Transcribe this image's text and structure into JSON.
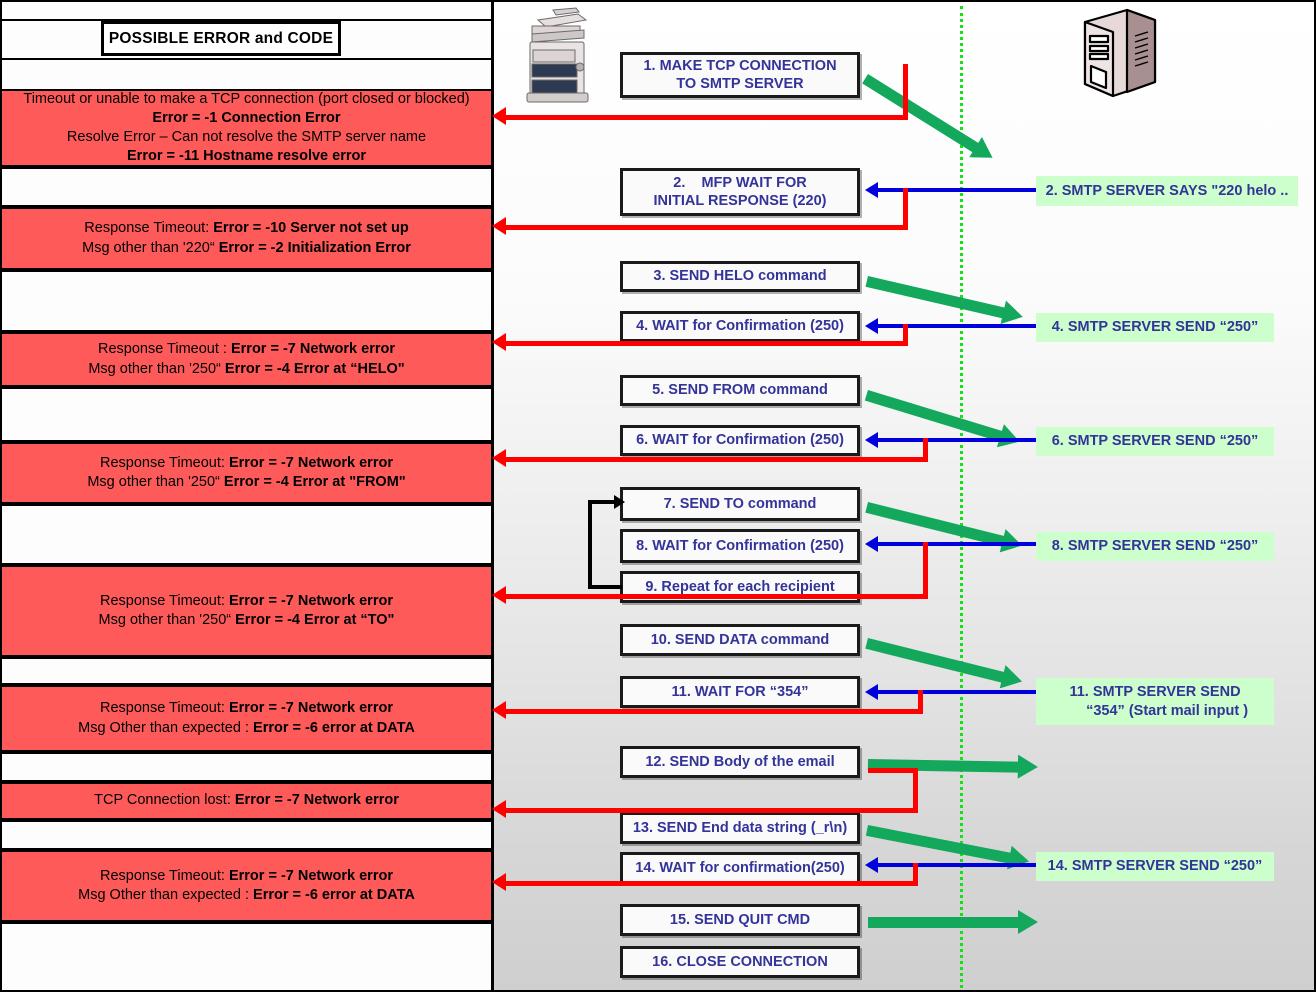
{
  "title_box": {
    "label": "POSSIBLE ERROR and CODE"
  },
  "devices": {
    "mfp": {
      "name": "mfp-printer-icon"
    },
    "server": {
      "name": "smtp-server-icon"
    }
  },
  "errors": [
    {
      "id": "err-1",
      "lines": [
        {
          "t": "Timeout or unable to make a TCP connection (port closed or blocked)",
          "b": false
        },
        {
          "t": "Error = -1 Connection Error",
          "b": true
        },
        {
          "t": "Resolve Error – Can not resolve the SMTP server name",
          "b": false
        },
        {
          "t": "Error = -11 Hostname resolve error",
          "b": true
        }
      ]
    },
    {
      "id": "err-2",
      "lines": [
        {
          "t": "Response Timeout: ",
          "b": false
        },
        {
          "t": "Error = -10 Server not set up",
          "b": true
        },
        {
          "t": "\n",
          "b": false
        },
        {
          "t": "Msg other than '220“ ",
          "b": false
        },
        {
          "t": "Error = -2 Initialization Error",
          "b": true
        }
      ]
    },
    {
      "id": "err-3",
      "lines": [
        {
          "t": "Response Timeout : ",
          "b": false
        },
        {
          "t": "Error = -7 Network error",
          "b": true
        },
        {
          "t": "\n",
          "b": false
        },
        {
          "t": "Msg other than '250“ ",
          "b": false
        },
        {
          "t": "Error = -4 Error at “HELO\"",
          "b": true
        }
      ]
    },
    {
      "id": "err-4",
      "lines": [
        {
          "t": "Response Timeout: ",
          "b": false
        },
        {
          "t": "Error = -7 Network error",
          "b": true
        },
        {
          "t": "\n",
          "b": false
        },
        {
          "t": "Msg other than '250“ ",
          "b": false
        },
        {
          "t": "Error = -4 Error at \"FROM\"",
          "b": true
        }
      ]
    },
    {
      "id": "err-5",
      "lines": [
        {
          "t": "Response  Timeout:  ",
          "b": false
        },
        {
          "t": "Error = -7  Network  error",
          "b": true
        },
        {
          "t": "\n",
          "b": false
        },
        {
          "t": "Msg other than '250“ ",
          "b": false
        },
        {
          "t": "Error = -4 Error at “TO\"",
          "b": true
        }
      ]
    },
    {
      "id": "err-6",
      "lines": [
        {
          "t": "Response Timeout: ",
          "b": false
        },
        {
          "t": "Error = -7 Network error",
          "b": true
        },
        {
          "t": "\n",
          "b": false
        },
        {
          "t": "Msg Other than expected : ",
          "b": false
        },
        {
          "t": "Error = -6 error at DATA",
          "b": true
        }
      ]
    },
    {
      "id": "err-7",
      "lines": [
        {
          "t": "TCP Connection lost: ",
          "b": false
        },
        {
          "t": "Error = -7 Network error",
          "b": true
        }
      ]
    },
    {
      "id": "err-8",
      "lines": [
        {
          "t": "Response Timeout: ",
          "b": false
        },
        {
          "t": "Error = -7 Network error",
          "b": true
        },
        {
          "t": "\n",
          "b": false
        },
        {
          "t": "Msg Other than expected : ",
          "b": false
        },
        {
          "t": "Error = -6 error at DATA",
          "b": true
        }
      ]
    }
  ],
  "steps": [
    {
      "id": "step-1",
      "text": "1. MAKE TCP CONNECTION\nTO SMTP SERVER"
    },
    {
      "id": "step-2",
      "text": "2.    MFP WAIT FOR\nINITIAL RESPONSE (220)"
    },
    {
      "id": "step-3",
      "text": "3.    SEND HELO command"
    },
    {
      "id": "step-4",
      "text": "4.    WAIT for Confirmation (250)"
    },
    {
      "id": "step-5",
      "text": "5.    SEND FROM command"
    },
    {
      "id": "step-6",
      "text": "6.    WAIT for Confirmation (250)"
    },
    {
      "id": "step-7",
      "text": "7.    SEND TO command"
    },
    {
      "id": "step-8",
      "text": "8.    WAIT for Confirmation (250)"
    },
    {
      "id": "step-9",
      "text": "9.    Repeat for each recipient"
    },
    {
      "id": "step-10",
      "text": "10.  SEND DATA command"
    },
    {
      "id": "step-11",
      "text": "11.  WAIT FOR “354”"
    },
    {
      "id": "step-12",
      "text": "12.  SEND Body of the email"
    },
    {
      "id": "step-13",
      "text": "13.  SEND End data string (_r\\n)"
    },
    {
      "id": "step-14",
      "text": "14.  WAIT for confirmation(250)"
    },
    {
      "id": "step-15",
      "text": "15.  SEND QUIT CMD"
    },
    {
      "id": "step-16",
      "text": "16. CLOSE CONNECTION"
    }
  ],
  "server_replies": [
    {
      "id": "srv-2",
      "text": "2. SMTP SERVER SAYS \"220 helo .."
    },
    {
      "id": "srv-4",
      "text": "4. SMTP SERVER SEND “250”"
    },
    {
      "id": "srv-6",
      "text": "6. SMTP SERVER SEND “250”"
    },
    {
      "id": "srv-8",
      "text": "8. SMTP SERVER SEND “250”"
    },
    {
      "id": "srv-11",
      "text": "11. SMTP SERVER SEND\n      “354” (Start mail input )"
    },
    {
      "id": "srv-14",
      "text": "14. SMTP SERVER SEND “250”"
    }
  ],
  "colors": {
    "error_fill": "#FF5A5A",
    "server_fill": "#CCFFCC",
    "step_text": "#333399",
    "error_arrow": "#FF0000",
    "response_arrow": "#0000DD",
    "send_arrow": "#13A85C",
    "divider": "#16E016"
  }
}
